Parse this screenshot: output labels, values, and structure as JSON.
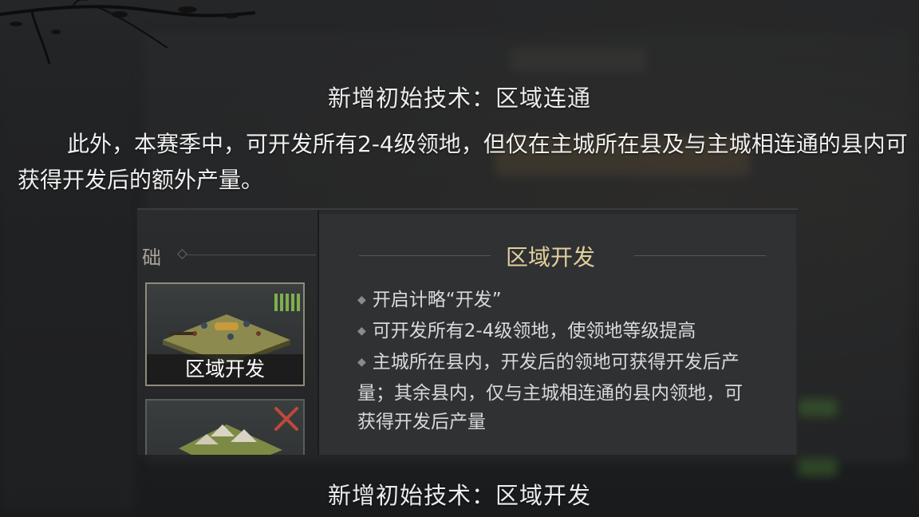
{
  "top_heading": "新增初始技术：区域连通",
  "paragraph": "此外，本赛季中，可开发所有2-4级领地，但仅在主城所在县及与主城相连通的县内可获得开发后的额外产量。",
  "inset": {
    "section_label": "础",
    "cards": [
      {
        "label": "区域开发",
        "badge_icon": "grain-bars-icon"
      },
      {
        "label": "",
        "badge_icon": "crossed-swords-icon"
      }
    ],
    "panel": {
      "title": "区域开发",
      "items": [
        "开启计略“开发”",
        "可开发所有2-4级领地，使领地等级提高",
        "主城所在县内，开发后的领地可获得开发后产量；其余县内，仅与主城相连通的县内领地，可获得开发后产量"
      ]
    }
  },
  "bottom_heading": "新增初始技术：区域开发",
  "colors": {
    "panel_title": "#e2cf9c",
    "badge_green": "#7fae4e",
    "swords_red": "#c0483a"
  }
}
